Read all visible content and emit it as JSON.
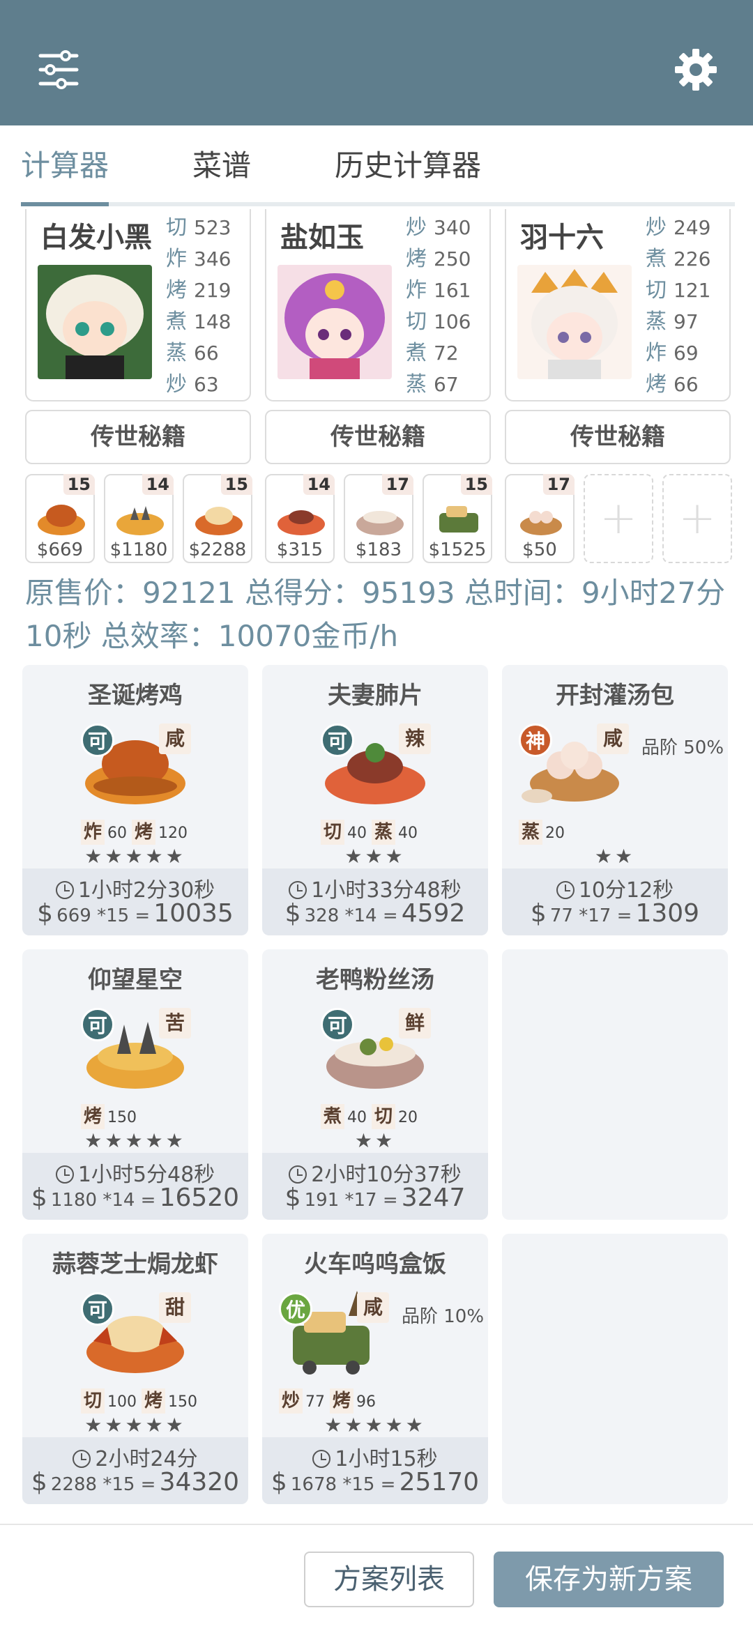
{
  "tabs": [
    {
      "label": "计算器"
    },
    {
      "label": "菜谱"
    },
    {
      "label": "历史计算器"
    }
  ],
  "chefs": [
    {
      "name": "白发小黑",
      "stats": [
        {
          "skill": "切",
          "value": "523"
        },
        {
          "skill": "炸",
          "value": "346"
        },
        {
          "skill": "烤",
          "value": "219"
        },
        {
          "skill": "煮",
          "value": "148"
        },
        {
          "skill": "蒸",
          "value": "66"
        },
        {
          "skill": "炒",
          "value": "63"
        }
      ],
      "secret": "传世秘籍"
    },
    {
      "name": "盐如玉",
      "stats": [
        {
          "skill": "炒",
          "value": "340"
        },
        {
          "skill": "烤",
          "value": "250"
        },
        {
          "skill": "炸",
          "value": "161"
        },
        {
          "skill": "切",
          "value": "106"
        },
        {
          "skill": "煮",
          "value": "72"
        },
        {
          "skill": "蒸",
          "value": "67"
        }
      ],
      "secret": "传世秘籍"
    },
    {
      "name": "羽十六",
      "stats": [
        {
          "skill": "炒",
          "value": "249"
        },
        {
          "skill": "煮",
          "value": "226"
        },
        {
          "skill": "切",
          "value": "121"
        },
        {
          "skill": "蒸",
          "value": "97"
        },
        {
          "skill": "炸",
          "value": "69"
        },
        {
          "skill": "烤",
          "value": "66"
        }
      ],
      "secret": "传世秘籍"
    }
  ],
  "thumbs": [
    {
      "count": "15",
      "price": "$669"
    },
    {
      "count": "14",
      "price": "$1180"
    },
    {
      "count": "15",
      "price": "$2288"
    },
    {
      "count": "14",
      "price": "$315"
    },
    {
      "count": "17",
      "price": "$183"
    },
    {
      "count": "15",
      "price": "$1525"
    },
    {
      "count": "17",
      "price": "$50"
    },
    {
      "plus": "+"
    },
    {
      "plus": "+"
    }
  ],
  "summary": "原售价：92121 总得分：95193 总时间：9小时27分10秒 总效率：10070金币/h",
  "recipes": [
    {
      "title": "圣诞烤鸡",
      "badge": "可",
      "flavor": "咸",
      "grade": "",
      "skills": [
        {
          "s": "炸",
          "v": "60"
        },
        {
          "s": "烤",
          "v": "120"
        }
      ],
      "stars": "★★★★★",
      "time": "1小时2分30秒",
      "dollar": "$",
      "mid": "669 *15 =",
      "total": "10035"
    },
    {
      "title": "夫妻肺片",
      "badge": "可",
      "flavor": "辣",
      "grade": "",
      "skills": [
        {
          "s": "切",
          "v": "40"
        },
        {
          "s": "蒸",
          "v": "40"
        }
      ],
      "stars": "★★★",
      "time": "1小时33分48秒",
      "dollar": "$",
      "mid": "328 *14 =",
      "total": "4592"
    },
    {
      "title": "开封灌汤包",
      "badge": "神",
      "flavor": "咸",
      "grade": "品阶 50%",
      "skills": [
        {
          "s": "蒸",
          "v": "20"
        }
      ],
      "stars": "★★",
      "time": "10分12秒",
      "dollar": "$",
      "mid": "77 *17 =",
      "total": "1309"
    },
    {
      "title": "仰望星空",
      "badge": "可",
      "flavor": "苦",
      "grade": "",
      "skills": [
        {
          "s": "烤",
          "v": "150"
        }
      ],
      "stars": "★★★★★",
      "time": "1小时5分48秒",
      "dollar": "$",
      "mid": "1180 *14 =",
      "total": "16520"
    },
    {
      "title": "老鸭粉丝汤",
      "badge": "可",
      "flavor": "鲜",
      "grade": "",
      "skills": [
        {
          "s": "煮",
          "v": "40"
        },
        {
          "s": "切",
          "v": "20"
        }
      ],
      "stars": "★★",
      "time": "2小时10分37秒",
      "dollar": "$",
      "mid": "191 *17 =",
      "total": "3247"
    },
    {
      "title": "蒜蓉芝士焗龙虾",
      "badge": "可",
      "flavor": "甜",
      "grade": "",
      "skills": [
        {
          "s": "切",
          "v": "100"
        },
        {
          "s": "烤",
          "v": "150"
        }
      ],
      "stars": "★★★★★",
      "time": "2小时24分",
      "dollar": "$",
      "mid": "2288 *15 =",
      "total": "34320"
    },
    {
      "title": "火车呜呜盒饭",
      "badge": "优",
      "flavor": "咸",
      "grade": "品阶 10%",
      "skills": [
        {
          "s": "炒",
          "v": "77"
        },
        {
          "s": "烤",
          "v": "96"
        }
      ],
      "stars": "★★★★★",
      "time": "1小时15秒",
      "dollar": "$",
      "mid": "1678 *15 =",
      "total": "25170"
    }
  ],
  "bottom": {
    "list_label": "方案列表",
    "save_label": "保存为新方案"
  },
  "colors": {
    "header": "#5f7e8d",
    "accent": "#6d8e9f",
    "save_button": "#7e9aab"
  }
}
